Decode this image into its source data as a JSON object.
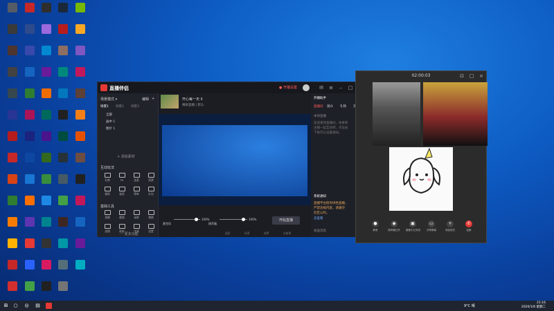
{
  "desktop": {
    "icons": [
      {
        "label": "",
        "color": "#555c66"
      },
      {
        "label": "",
        "color": "#c62828"
      },
      {
        "label": "",
        "color": "#2e2e2e"
      },
      {
        "label": "",
        "color": "#1b2838"
      },
      {
        "label": "",
        "color": "#76b900"
      },
      {
        "label": "",
        "color": "#3a3a3a"
      },
      {
        "label": "",
        "color": "#2d4a8a"
      },
      {
        "label": "",
        "color": "#9c6ade"
      },
      {
        "label": "",
        "color": "#b71c1c"
      },
      {
        "label": "",
        "color": "#f9a825"
      },
      {
        "label": "",
        "color": "#4e342e"
      },
      {
        "label": "",
        "color": "#3949ab"
      },
      {
        "label": "",
        "color": "#0288d1"
      },
      {
        "label": "",
        "color": "#8d6e63"
      },
      {
        "label": "",
        "color": "#7e57c2"
      },
      {
        "label": "",
        "color": "#424242"
      },
      {
        "label": "",
        "color": "#1565c0"
      },
      {
        "label": "",
        "color": "#6a1b9a"
      },
      {
        "label": "",
        "color": "#00897b"
      },
      {
        "label": "",
        "color": "#c2185b"
      },
      {
        "label": "",
        "color": "#37474f"
      },
      {
        "label": "",
        "color": "#2e7d32"
      },
      {
        "label": "",
        "color": "#ef6c00"
      },
      {
        "label": "",
        "color": "#0277bd"
      },
      {
        "label": "",
        "color": "#5d4037"
      },
      {
        "label": "",
        "color": "#283593"
      },
      {
        "label": "",
        "color": "#ad1457"
      },
      {
        "label": "",
        "color": "#00695c"
      },
      {
        "label": "",
        "color": "#212121"
      },
      {
        "label": "",
        "color": "#f57f17"
      },
      {
        "label": "",
        "color": "#b71c1c"
      },
      {
        "label": "",
        "color": "#1a237e"
      },
      {
        "label": "",
        "color": "#4a148c"
      },
      {
        "label": "",
        "color": "#004d40"
      },
      {
        "label": "",
        "color": "#e65100"
      },
      {
        "label": "",
        "color": "#c62828"
      },
      {
        "label": "",
        "color": "#0d47a1"
      },
      {
        "label": "",
        "color": "#33691e"
      },
      {
        "label": "",
        "color": "#263238"
      },
      {
        "label": "",
        "color": "#6d4c41"
      },
      {
        "label": "",
        "color": "#d84315"
      },
      {
        "label": "",
        "color": "#1976d2"
      },
      {
        "label": "",
        "color": "#388e3c"
      },
      {
        "label": "",
        "color": "#455a64"
      },
      {
        "label": "",
        "color": "#212121"
      },
      {
        "label": "",
        "color": "#2e7d32"
      },
      {
        "label": "",
        "color": "#ff6f00"
      },
      {
        "label": "",
        "color": "#1e88e5"
      },
      {
        "label": "",
        "color": "#43a047"
      },
      {
        "label": "",
        "color": "#c2185b"
      },
      {
        "label": "",
        "color": "#f57c00"
      },
      {
        "label": "",
        "color": "#5e35b1"
      },
      {
        "label": "",
        "color": "#00838f"
      },
      {
        "label": "",
        "color": "#3e2723"
      },
      {
        "label": "",
        "color": "#1565c0"
      },
      {
        "label": "",
        "color": "#ffb300"
      },
      {
        "label": "",
        "color": "#e53935"
      },
      {
        "label": "",
        "color": "#333333"
      },
      {
        "label": "",
        "color": "#0097a7"
      },
      {
        "label": "",
        "color": "#6a1b9a"
      },
      {
        "label": "",
        "color": "#c62828"
      },
      {
        "label": "",
        "color": "#2962ff"
      },
      {
        "label": "",
        "color": "#d81b60"
      },
      {
        "label": "",
        "color": "#546e7a"
      },
      {
        "label": "",
        "color": "#00acc1"
      },
      {
        "label": "",
        "color": "#d32f2f"
      },
      {
        "label": "",
        "color": "#43a047"
      },
      {
        "label": "",
        "color": "#212121"
      },
      {
        "label": "",
        "color": "#757575"
      }
    ]
  },
  "stream_app": {
    "app_name": "直播伴侣",
    "start_live": "● 开播设置",
    "left": {
      "scene_header": "场景模式 ▾",
      "scene_edit": "编辑",
      "scene_more": "+",
      "tab_labels": [
        "场景1",
        "场景2",
        "场景3"
      ],
      "items": [
        "全部",
        "画中 1",
        "图片 1"
      ],
      "add_source": "+ 添加素材",
      "section_interact": "互动玩法",
      "section_tools": "基础工具",
      "more_functions": "⋯ 更多功能",
      "interact_buttons": [
        "礼物",
        "PK",
        "连麦",
        "投票",
        "福袋",
        "抽奖",
        "榜单",
        "红包"
      ],
      "tool_buttons": [
        "直播",
        "截图",
        "录屏",
        "美颜",
        "滤镜",
        "贴纸",
        "字幕",
        "设置"
      ]
    },
    "main": {
      "scene_title": "开心每一天 II",
      "scene_subtitle": "横屏直播  |  默认",
      "mic_label": "麦克风",
      "speaker_label": "扬声器",
      "mic_value": "100%",
      "speaker_value": "100%",
      "go_live": "开始直播",
      "footer_labels": [
        "画质",
        "码率",
        "帧率",
        "分辨率"
      ]
    },
    "right": {
      "room_label": "开播助手",
      "tabs": [
        "直播间",
        "观众",
        "礼物",
        "消息"
      ],
      "notice_title": "本场直播",
      "notice_lines": [
        "欢迎来到直播间，快来和",
        "主播一起互动吧，点击右",
        "下角可以设置通知。"
      ],
      "message_title": "系统通知",
      "message_lines": [
        "直播平台倡导绿色直播，",
        "严禁违规内容，请遵守",
        "社区公约。"
      ],
      "message_link": "去查看",
      "chat_label": "发送消息"
    }
  },
  "call_window": {
    "timer": "02:00:03",
    "controls": [
      {
        "icon": "●",
        "label": "静音"
      },
      {
        "icon": "◉",
        "label": "扬声器已开"
      },
      {
        "icon": "▣",
        "label": "摄像头已关闭"
      },
      {
        "icon": "▭",
        "label": "共享屏幕"
      },
      {
        "icon": "+",
        "label": "添加成员"
      },
      {
        "icon": "✆",
        "label": "挂断"
      }
    ]
  },
  "taskbar": {
    "weather": "9°C 晴",
    "time": "21:16",
    "date": "2020/1/6 星期二"
  }
}
